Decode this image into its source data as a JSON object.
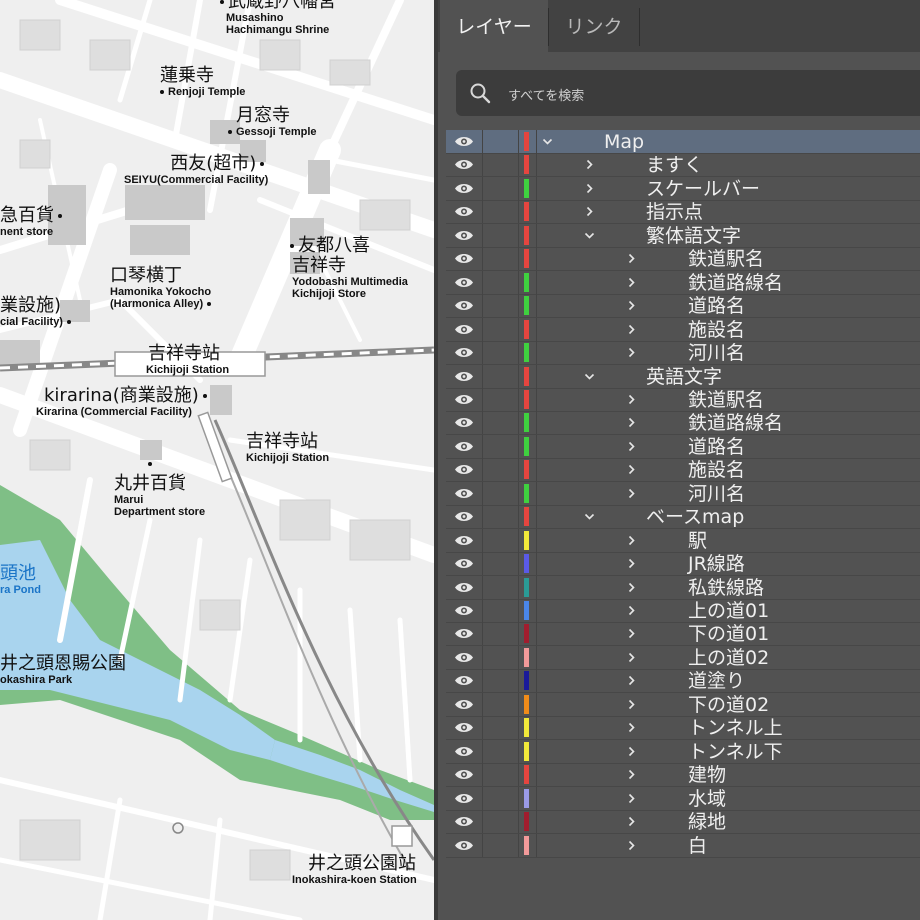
{
  "map": {
    "labels": [
      {
        "id": "musashino",
        "jp": "武蔵野八幡宮",
        "en": "Musashino Hachimangu Shrine",
        "dot": "before"
      },
      {
        "id": "renjoji",
        "jp": "蓮乗寺",
        "en": "Renjoji Temple",
        "dot": "en-before"
      },
      {
        "id": "gessoji",
        "jp": "月窓寺",
        "en": "Gessoji Temple",
        "dot": "en-before"
      },
      {
        "id": "seiyu",
        "jp": "西友(超市)",
        "en": "SEIYU(Commercial Facility)",
        "dot": "after"
      },
      {
        "id": "dept-left",
        "jp": "急百貨",
        "en": "nent store",
        "dot": "after"
      },
      {
        "id": "tomoto",
        "jp": "友都八喜 吉祥寺",
        "en": "Yodobashi Multimedia Kichijoji Store",
        "dot": "before"
      },
      {
        "id": "hamonika",
        "jp": "口琴横丁",
        "en": "Hamonika Yokocho (Harmonica Alley)",
        "dot": "after"
      },
      {
        "id": "shogyo-left",
        "jp": "業設施)",
        "en": "cial Facility)",
        "dot": "after"
      },
      {
        "id": "kichijoji-station-1",
        "jp": "吉祥寺站",
        "en": "Kichijoji Station",
        "dot": ""
      },
      {
        "id": "kirarina",
        "jp": "kirarina(商業設施)",
        "en": "Kirarina (Commercial Facility)",
        "dot": "after"
      },
      {
        "id": "kichijoji-station-2",
        "jp": "吉祥寺站",
        "en": "Kichijoji Station",
        "dot": ""
      },
      {
        "id": "marui",
        "jp": "丸井百貨",
        "en": "Marui Department store",
        "dot": "before"
      },
      {
        "id": "pond",
        "jp": "頭池",
        "en": "ra Pond",
        "dot": ""
      },
      {
        "id": "park",
        "jp": "井之頭恩賜公園",
        "en": "okashira Park",
        "dot": ""
      },
      {
        "id": "inokashira-station",
        "jp": "井之頭公園站",
        "en": "Inokashira-koen Station",
        "dot": ""
      }
    ]
  },
  "panel": {
    "tabs": [
      {
        "label": "レイヤー",
        "active": true
      },
      {
        "label": "リンク",
        "active": false
      }
    ],
    "search": {
      "placeholder": "すべてを検索",
      "icon": "search-icon"
    },
    "layers": [
      {
        "name": "Map",
        "level": 0,
        "expanded": true,
        "color": "#e5453f",
        "selected": true
      },
      {
        "name": "ますく",
        "level": 1,
        "expanded": false,
        "color": "#e5453f"
      },
      {
        "name": "スケールバー",
        "level": 1,
        "expanded": false,
        "color": "#3fd13f"
      },
      {
        "name": "指示点",
        "level": 1,
        "expanded": false,
        "color": "#e5453f"
      },
      {
        "name": "繁体語文字",
        "level": 1,
        "expanded": true,
        "color": "#e5453f"
      },
      {
        "name": "鉄道駅名",
        "level": 2,
        "expanded": false,
        "color": "#e5453f"
      },
      {
        "name": "鉄道路線名",
        "level": 2,
        "expanded": false,
        "color": "#3fd13f"
      },
      {
        "name": "道路名",
        "level": 2,
        "expanded": false,
        "color": "#3fd13f"
      },
      {
        "name": "施設名",
        "level": 2,
        "expanded": false,
        "color": "#e5453f"
      },
      {
        "name": "河川名",
        "level": 2,
        "expanded": false,
        "color": "#3fd13f"
      },
      {
        "name": "英語文字",
        "level": 1,
        "expanded": true,
        "color": "#e5453f"
      },
      {
        "name": "鉄道駅名",
        "level": 2,
        "expanded": false,
        "color": "#e5453f"
      },
      {
        "name": "鉄道路線名",
        "level": 2,
        "expanded": false,
        "color": "#3fd13f"
      },
      {
        "name": "道路名",
        "level": 2,
        "expanded": false,
        "color": "#3fd13f"
      },
      {
        "name": "施設名",
        "level": 2,
        "expanded": false,
        "color": "#e5453f"
      },
      {
        "name": "河川名",
        "level": 2,
        "expanded": false,
        "color": "#3fd13f"
      },
      {
        "name": "ベースmap",
        "level": 1,
        "expanded": true,
        "color": "#e5453f"
      },
      {
        "name": "駅",
        "level": 2,
        "expanded": false,
        "color": "#f2e93a"
      },
      {
        "name": "JR線路",
        "level": 2,
        "expanded": false,
        "color": "#5a5ae6"
      },
      {
        "name": "私鉄線路",
        "level": 2,
        "expanded": false,
        "color": "#2a9b96"
      },
      {
        "name": "上の道01",
        "level": 2,
        "expanded": false,
        "color": "#4a86e8"
      },
      {
        "name": "下の道01",
        "level": 2,
        "expanded": false,
        "color": "#a11d2e"
      },
      {
        "name": "上の道02",
        "level": 2,
        "expanded": false,
        "color": "#f29a9a"
      },
      {
        "name": "道塗り",
        "level": 2,
        "expanded": false,
        "color": "#1a1a9a"
      },
      {
        "name": "下の道02",
        "level": 2,
        "expanded": false,
        "color": "#f08c1a"
      },
      {
        "name": "トンネル上",
        "level": 2,
        "expanded": false,
        "color": "#f2e93a"
      },
      {
        "name": "トンネル下",
        "level": 2,
        "expanded": false,
        "color": "#f2e93a"
      },
      {
        "name": "建物",
        "level": 2,
        "expanded": false,
        "color": "#e5453f"
      },
      {
        "name": "水域",
        "level": 2,
        "expanded": false,
        "color": "#9a9ae6"
      },
      {
        "name": "緑地",
        "level": 2,
        "expanded": false,
        "color": "#a11d2e"
      },
      {
        "name": "白",
        "level": 2,
        "expanded": false,
        "color": "#f29a9a"
      }
    ]
  }
}
